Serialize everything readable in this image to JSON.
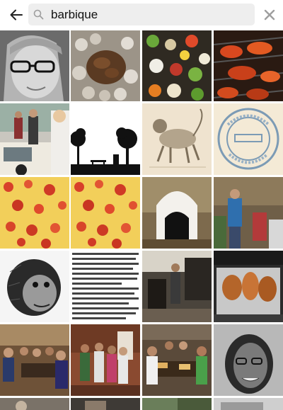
{
  "search": {
    "query": "barbique"
  },
  "icons": {
    "back": "back-arrow-icon",
    "search": "search-icon",
    "clear": "close-icon"
  },
  "colors": {
    "search_background": "#eeeeee",
    "icon_gray": "#9e9e9e",
    "background": "#ffffff"
  },
  "results": [
    {
      "row": 1,
      "items": [
        "grayscale-girl-with-glasses",
        "grilled-meat-on-stones",
        "vegetable-kebabs",
        "grilled-crayfish"
      ]
    },
    {
      "row": 2,
      "items": [
        "people-by-car",
        "silhouette-picnic-scene",
        "monkey-engraving",
        "marine-biological-library-stamp"
      ]
    },
    {
      "row": 3,
      "items": [
        "pizza-closeup",
        "pizza-closeup-duplicate",
        "outdoor-oven",
        "man-at-grill-with-chairs"
      ]
    },
    {
      "row": 4,
      "items": [
        "ape-head-engraving",
        "french-text-page",
        "restaurant-bar-interior",
        "grilled-food-on-foil"
      ]
    },
    {
      "row": 5,
      "items": [
        "group-dinner-table",
        "group-standing-indoors",
        "family-dinner-restaurant",
        "smiling-woman-portrait"
      ]
    },
    {
      "row": 6,
      "items": [
        "partial-image-1",
        "partial-image-2",
        "partial-image-3",
        "partial-image-4"
      ]
    }
  ]
}
